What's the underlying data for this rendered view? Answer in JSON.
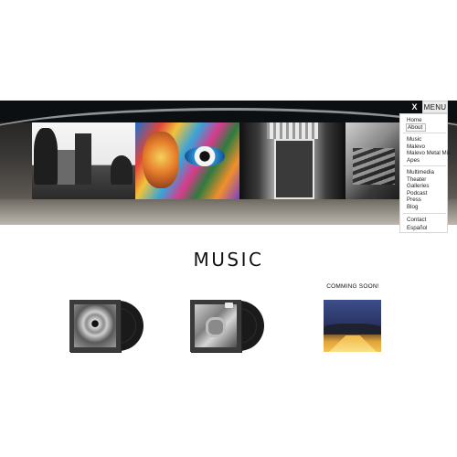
{
  "header": {
    "close_label": "X",
    "menu_label": "MENU"
  },
  "menu": {
    "items": [
      {
        "label": "Home"
      },
      {
        "label": "About"
      },
      {
        "label": "Music"
      },
      {
        "label": "Malevo"
      },
      {
        "label": "Malevo Metal Mix"
      },
      {
        "label": "Apes"
      },
      {
        "label": "Multimedia"
      },
      {
        "label": "Theater"
      },
      {
        "label": "Galleries"
      },
      {
        "label": "Podcast"
      },
      {
        "label": "Press"
      },
      {
        "label": "Blog"
      },
      {
        "label": "Contact"
      },
      {
        "label": "Español"
      }
    ]
  },
  "main": {
    "title": "MUSIC",
    "coming_soon": "COMMING SOON!"
  }
}
